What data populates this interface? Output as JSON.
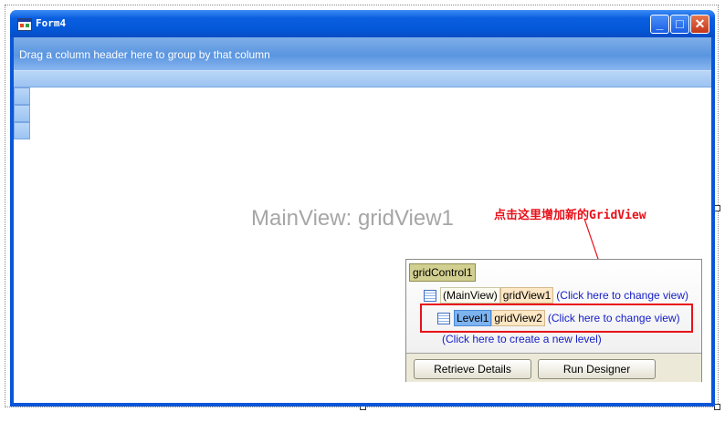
{
  "window": {
    "title": "Form4"
  },
  "grid": {
    "group_panel_text": "Drag a column header here to group by that column",
    "mainview_label": "MainView: gridView1"
  },
  "annotation": {
    "text": "点击这里增加新的GridView",
    "color": "#e8101a"
  },
  "level_designer": {
    "control_name": "gridControl1",
    "main_row": {
      "tag": "(MainView)",
      "view": "gridView1",
      "link": "(Click here to change view)"
    },
    "level_row": {
      "tag": "Level1",
      "view": "gridView2",
      "link": "(Click here to change view)"
    },
    "create_link": "(Click here to create a new level)",
    "retrieve_button": "Retrieve Details",
    "designer_button": "Run Designer"
  },
  "colors": {
    "titlebar": "#0a5fe0",
    "link": "#1720c9",
    "highlight": "#e81219"
  }
}
